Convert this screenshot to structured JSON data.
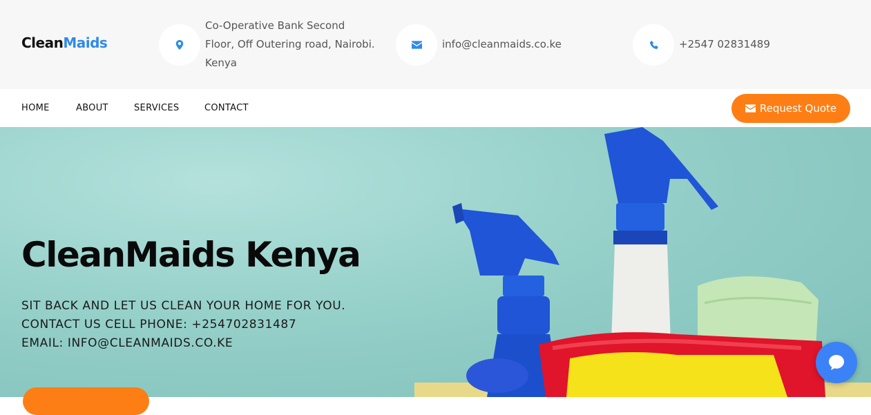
{
  "logo": {
    "part1": "Clean",
    "part2": "Maids"
  },
  "contact": {
    "address_lines": [
      "Co-Operative Bank Second",
      "Floor, Off Outering road, Nairobi.",
      "Kenya"
    ],
    "email": "info@cleanmaids.co.ke",
    "phone": "+2547 02831489"
  },
  "nav": {
    "items": [
      "HOME",
      "ABOUT",
      "SERVICES",
      "CONTACT"
    ]
  },
  "quote_button": {
    "label": "Request Quote"
  },
  "hero": {
    "title": "CleanMaids Kenya",
    "lines": [
      "SIT BACK AND LET US CLEAN YOUR HOME FOR YOU.",
      "CONTACT US CELL PHONE: +254702831487",
      "EMAIL: INFO@CLEANMAIDS.CO.KE"
    ]
  },
  "icons": {
    "address": "map-marker-icon",
    "email": "envelope-icon",
    "phone": "phone-icon",
    "chat": "chat-icon"
  },
  "colors": {
    "accent_orange": "#fd7e14",
    "brand_blue": "#2f8be6",
    "chat_blue": "#3b82f6",
    "hero_bg": "#95d0c9"
  }
}
